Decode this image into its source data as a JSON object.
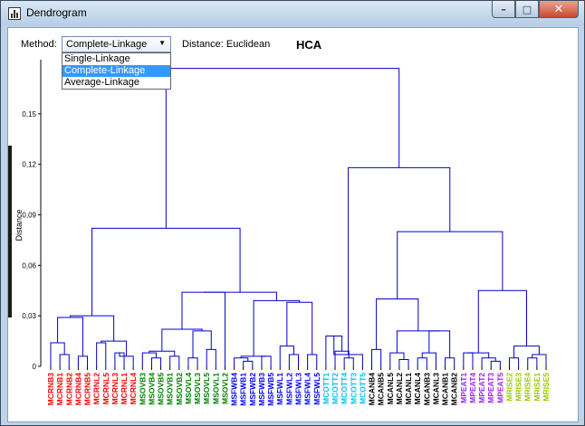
{
  "window": {
    "title": "Dendrogram",
    "minimize_glyph": "–",
    "maximize_glyph": "□",
    "close_glyph": "✕"
  },
  "controls": {
    "method_label": "Method:",
    "method_value": "Complete-Linkage",
    "method_options": [
      "Single-Linkage",
      "Complete-Linkage",
      "Average-Linkage"
    ],
    "distance_label": "Distance: Euclidean"
  },
  "colors": {
    "line": "#0000cc",
    "MCRNB": "#ff0000",
    "MSOV": "#008000",
    "MSFWB": "#0000ff",
    "MCOTT": "#00bfff",
    "MCANL": "#000000",
    "MPEAT": "#a020f0",
    "MRISE": "#99cc00"
  },
  "chart_data": {
    "type": "dendrogram",
    "title": "HCA",
    "ylabel": "Distance",
    "ylim": [
      0,
      0.18
    ],
    "yticks": [
      {
        "value": 0,
        "label": "0"
      },
      {
        "value": 0.03,
        "label": "0,03"
      },
      {
        "value": 0.06,
        "label": "0,06"
      },
      {
        "value": 0.09,
        "label": "0,09"
      },
      {
        "value": 0.12,
        "label": "0,12"
      },
      {
        "value": 0.15,
        "label": "0,15"
      }
    ],
    "leaves": [
      {
        "label": "MCRNB3",
        "group": "MCRNB"
      },
      {
        "label": "MCRNB1",
        "group": "MCRNB"
      },
      {
        "label": "MCRNB2",
        "group": "MCRNB"
      },
      {
        "label": "MCRNB4",
        "group": "MCRNB"
      },
      {
        "label": "MCRNB5",
        "group": "MCRNB"
      },
      {
        "label": "MCRNL2",
        "group": "MCRNB"
      },
      {
        "label": "MCRNL5",
        "group": "MCRNB"
      },
      {
        "label": "MCRNL3",
        "group": "MCRNB"
      },
      {
        "label": "MCRNL1",
        "group": "MCRNB"
      },
      {
        "label": "MCRNL4",
        "group": "MCRNB"
      },
      {
        "label": "MSOVB3",
        "group": "MSOV"
      },
      {
        "label": "MSOVB4",
        "group": "MSOV"
      },
      {
        "label": "MSOVB5",
        "group": "MSOV"
      },
      {
        "label": "MSOVB1",
        "group": "MSOV"
      },
      {
        "label": "MSOVB2",
        "group": "MSOV"
      },
      {
        "label": "MSOVL4",
        "group": "MSOV"
      },
      {
        "label": "MSOVL3",
        "group": "MSOV"
      },
      {
        "label": "MSOVL5",
        "group": "MSOV"
      },
      {
        "label": "MSOVL1",
        "group": "MSOV"
      },
      {
        "label": "MSOVL2",
        "group": "MSOV"
      },
      {
        "label": "MSFWB4",
        "group": "MSFWB"
      },
      {
        "label": "MSFWB1",
        "group": "MSFWB"
      },
      {
        "label": "MSFWB2",
        "group": "MSFWB"
      },
      {
        "label": "MSFWB3",
        "group": "MSFWB"
      },
      {
        "label": "MSFWB5",
        "group": "MSFWB"
      },
      {
        "label": "MSFWL1",
        "group": "MSFWB"
      },
      {
        "label": "MSFWL2",
        "group": "MSFWB"
      },
      {
        "label": "MSFWL3",
        "group": "MSFWB"
      },
      {
        "label": "MSFWL4",
        "group": "MSFWB"
      },
      {
        "label": "MSFWL5",
        "group": "MSFWB"
      },
      {
        "label": "MCOTT1",
        "group": "MCOTT"
      },
      {
        "label": "MCOTT2",
        "group": "MCOTT"
      },
      {
        "label": "MCOTT4",
        "group": "MCOTT"
      },
      {
        "label": "MCOTT3",
        "group": "MCOTT"
      },
      {
        "label": "MCOTT5",
        "group": "MCOTT"
      },
      {
        "label": "MCANB4",
        "group": "MCANL"
      },
      {
        "label": "MCANB5",
        "group": "MCANL"
      },
      {
        "label": "MCANL5",
        "group": "MCANL"
      },
      {
        "label": "MCANL2",
        "group": "MCANL"
      },
      {
        "label": "MCANL1",
        "group": "MCANL"
      },
      {
        "label": "MCANL4",
        "group": "MCANL"
      },
      {
        "label": "MCANB3",
        "group": "MCANL"
      },
      {
        "label": "MCANL3",
        "group": "MCANL"
      },
      {
        "label": "MCANB1",
        "group": "MCANL"
      },
      {
        "label": "MCANB2",
        "group": "MCANL"
      },
      {
        "label": "MPEAT1",
        "group": "MPEAT"
      },
      {
        "label": "MPEAT4",
        "group": "MPEAT"
      },
      {
        "label": "MPEAT2",
        "group": "MPEAT"
      },
      {
        "label": "MPEAT3",
        "group": "MPEAT"
      },
      {
        "label": "MPEAT5",
        "group": "MPEAT"
      },
      {
        "label": "MRISE2",
        "group": "MRISE"
      },
      {
        "label": "MRISE3",
        "group": "MRISE"
      },
      {
        "label": "MRISE4",
        "group": "MRISE"
      },
      {
        "label": "MRISE1",
        "group": "MRISE"
      },
      {
        "label": "MRISE5",
        "group": "MRISE"
      }
    ],
    "merges": [
      {
        "a": 1,
        "b": 2,
        "h": 0.007
      },
      {
        "a": 0,
        "b": -1,
        "h": 0.014
      },
      {
        "a": 3,
        "b": 4,
        "h": 0.006
      },
      {
        "a": -2,
        "b": -3,
        "h": 0.029
      },
      {
        "a": 7,
        "b": 8,
        "h": 0.008
      },
      {
        "a": -5,
        "b": 9,
        "h": 0.006
      },
      {
        "a": 5,
        "b": 6,
        "h": 0.014
      },
      {
        "a": -7,
        "b": -6,
        "h": 0.015
      },
      {
        "a": -4,
        "b": -8,
        "h": 0.03
      },
      {
        "a": 11,
        "b": 12,
        "h": 0.005
      },
      {
        "a": 13,
        "b": 14,
        "h": 0.006
      },
      {
        "a": 10,
        "b": -10,
        "h": 0.008
      },
      {
        "a": -12,
        "b": -11,
        "h": 0.009
      },
      {
        "a": 15,
        "b": 16,
        "h": 0.005
      },
      {
        "a": 17,
        "b": 18,
        "h": 0.01
      },
      {
        "a": -14,
        "b": -15,
        "h": 0.021
      },
      {
        "a": -13,
        "b": -16,
        "h": 0.022
      },
      {
        "a": 19,
        "b": -17,
        "h": 0.044
      },
      {
        "a": 21,
        "b": 22,
        "h": 0.003
      },
      {
        "a": 20,
        "b": -19,
        "h": 0.005
      },
      {
        "a": 23,
        "b": 24,
        "h": 0.006
      },
      {
        "a": -20,
        "b": -21,
        "h": 0.006
      },
      {
        "a": 26,
        "b": 27,
        "h": 0.007
      },
      {
        "a": 25,
        "b": -23,
        "h": 0.012
      },
      {
        "a": 28,
        "b": 29,
        "h": 0.007
      },
      {
        "a": -24,
        "b": -25,
        "h": 0.038
      },
      {
        "a": -22,
        "b": -26,
        "h": 0.039
      },
      {
        "a": -18,
        "b": -27,
        "h": 0.044
      },
      {
        "a": -9,
        "b": -28,
        "h": 0.082
      },
      {
        "a": 32,
        "b": 33,
        "h": 0.005
      },
      {
        "a": 31,
        "b": -30,
        "h": 0.009
      },
      {
        "a": 30,
        "b": -31,
        "h": 0.018
      },
      {
        "a": -32,
        "b": 34,
        "h": 0.007
      },
      {
        "a": 35,
        "b": 36,
        "h": 0.01
      },
      {
        "a": 38,
        "b": 39,
        "h": 0.004
      },
      {
        "a": 37,
        "b": -35,
        "h": 0.008
      },
      {
        "a": 40,
        "b": 41,
        "h": 0.005
      },
      {
        "a": -37,
        "b": 42,
        "h": 0.008
      },
      {
        "a": 43,
        "b": 44,
        "h": 0.005
      },
      {
        "a": -38,
        "b": -39,
        "h": 0.021
      },
      {
        "a": -36,
        "b": -40,
        "h": 0.021
      },
      {
        "a": -34,
        "b": -41,
        "h": 0.04
      },
      {
        "a": 48,
        "b": 49,
        "h": 0.003
      },
      {
        "a": 47,
        "b": -43,
        "h": 0.005
      },
      {
        "a": 45,
        "b": 46,
        "h": 0.008
      },
      {
        "a": -45,
        "b": -44,
        "h": 0.008
      },
      {
        "a": 52,
        "b": 53,
        "h": 0.005
      },
      {
        "a": 50,
        "b": 51,
        "h": 0.005
      },
      {
        "a": -47,
        "b": 54,
        "h": 0.007
      },
      {
        "a": -48,
        "b": -49,
        "h": 0.012
      },
      {
        "a": -46,
        "b": -50,
        "h": 0.045
      },
      {
        "a": -42,
        "b": -51,
        "h": 0.08
      },
      {
        "a": -33,
        "b": -52,
        "h": 0.118
      },
      {
        "a": -29,
        "b": -53,
        "h": 0.177
      }
    ]
  }
}
